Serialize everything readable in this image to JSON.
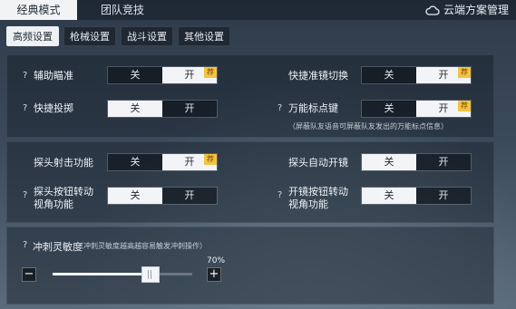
{
  "main_tabs": [
    {
      "label": "经典模式"
    },
    {
      "label": "团队竞技"
    }
  ],
  "cloud": {
    "label": "云端方案管理",
    "icon": "cloud-icon"
  },
  "sub_tabs": [
    {
      "label": "高频设置"
    },
    {
      "label": "枪械设置"
    },
    {
      "label": "战斗设置"
    },
    {
      "label": "其他设置"
    }
  ],
  "toggle_options": {
    "off": "关",
    "on": "开"
  },
  "badge": "荐",
  "question": "?",
  "settings": {
    "assist_aim": {
      "label": "辅助瞄准",
      "value": "开",
      "recommended": true
    },
    "quick_scope": {
      "label": "快捷准镜切换",
      "value": "开",
      "recommended": true
    },
    "quick_throw": {
      "label": "快捷投掷",
      "value": "关"
    },
    "universal_mark": {
      "label": "万能标点键",
      "value": "开",
      "recommended": true
    },
    "universal_mark_hint": "（屏蔽队友语音可屏蔽队友发出的万能标点信息）",
    "peek_fire": {
      "label": "探头射击功能",
      "value": "开",
      "recommended": true
    },
    "peek_auto_scope": {
      "label": "探头自动开镜",
      "value": "关"
    },
    "peek_button_rotate": {
      "label_line1": "探头按钮转动",
      "label_line2": "视角功能",
      "value": "关"
    },
    "scope_button_rotate": {
      "label_line1": "开镜按钮转动",
      "label_line2": "视角功能",
      "value": "关"
    }
  },
  "sprint": {
    "label": "冲刺灵敏度",
    "hint": "（冲刺灵敏度越高越容易触发冲刺操作）",
    "value_text": "70%",
    "value": 0.7,
    "minus": "−",
    "plus": "+"
  },
  "colors": {
    "on_bg": "#f2f4f7",
    "badge": "#f4c343"
  }
}
